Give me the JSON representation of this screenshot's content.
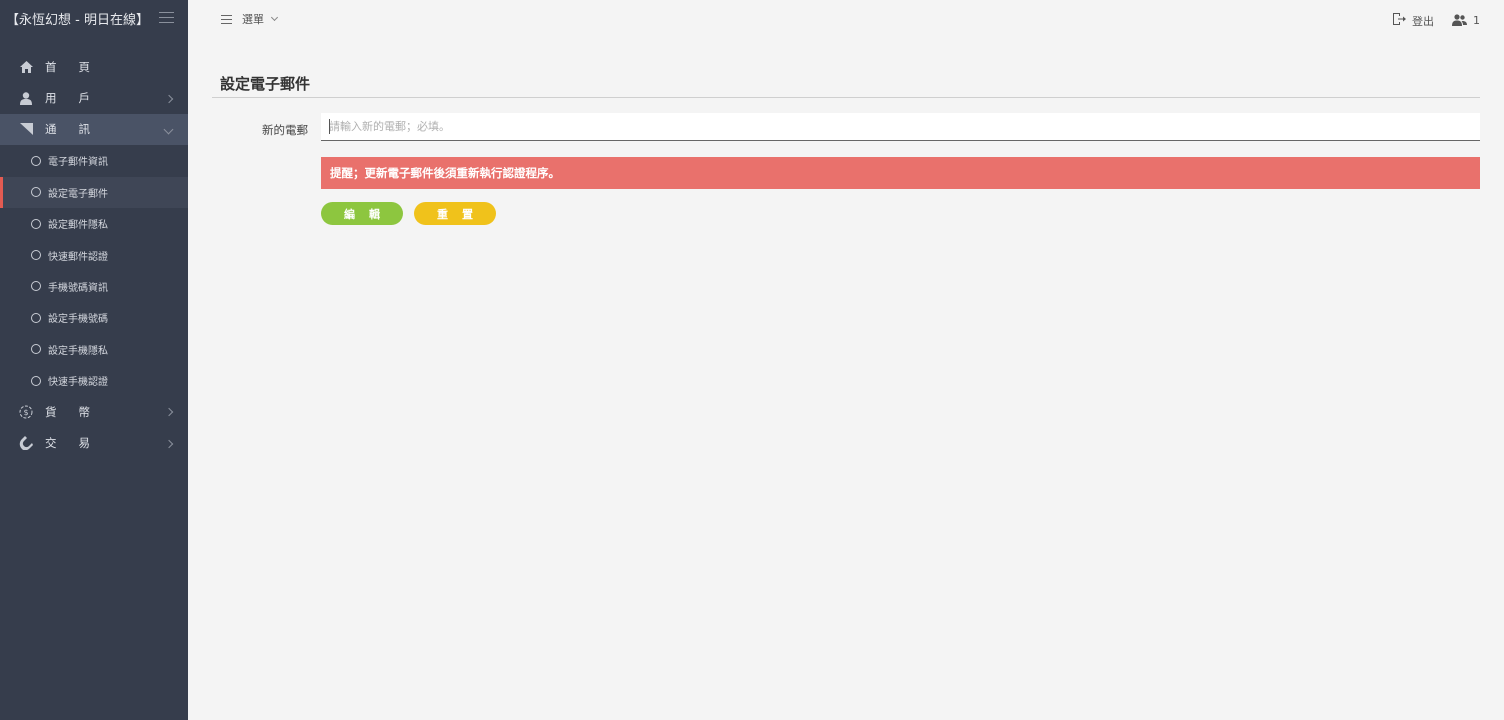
{
  "brand": {
    "title": "【永恆幻想 - 明日在線】"
  },
  "sidebar": {
    "items": [
      {
        "label": "首頁",
        "icon": "home-icon",
        "expandable": false
      },
      {
        "label": "用戶",
        "icon": "user-icon",
        "expandable": true
      },
      {
        "label": "通訊",
        "icon": "signal-icon",
        "expandable": true,
        "expanded": true,
        "children": [
          {
            "label": "電子郵件資訊"
          },
          {
            "label": "設定電子郵件",
            "active": true
          },
          {
            "label": "設定郵件隱私"
          },
          {
            "label": "快速郵件認證"
          },
          {
            "label": "手機號碼資訊"
          },
          {
            "label": "設定手機號碼"
          },
          {
            "label": "設定手機隱私"
          },
          {
            "label": "快速手機認證"
          }
        ]
      },
      {
        "label": "貨幣",
        "icon": "currency-icon",
        "expandable": true
      },
      {
        "label": "交易",
        "icon": "magnet-icon",
        "expandable": true
      }
    ]
  },
  "topbar": {
    "menu_label": "選單",
    "logout_label": "登出",
    "user_count": "1"
  },
  "main": {
    "title": "設定電子郵件",
    "field_label": "新的電郵",
    "field_placeholder": "請輸入新的電郵；必填。",
    "field_value": "",
    "alert": "提醒；更新電子郵件後須重新執行認證程序。",
    "edit_button": "編輯",
    "reset_button": "重置"
  },
  "colors": {
    "sidebar_bg": "#363d4c",
    "active_accent": "#e35b52",
    "alert_bg": "#e9716c",
    "edit_button": "#8dc63f",
    "reset_button": "#f0c21b"
  }
}
